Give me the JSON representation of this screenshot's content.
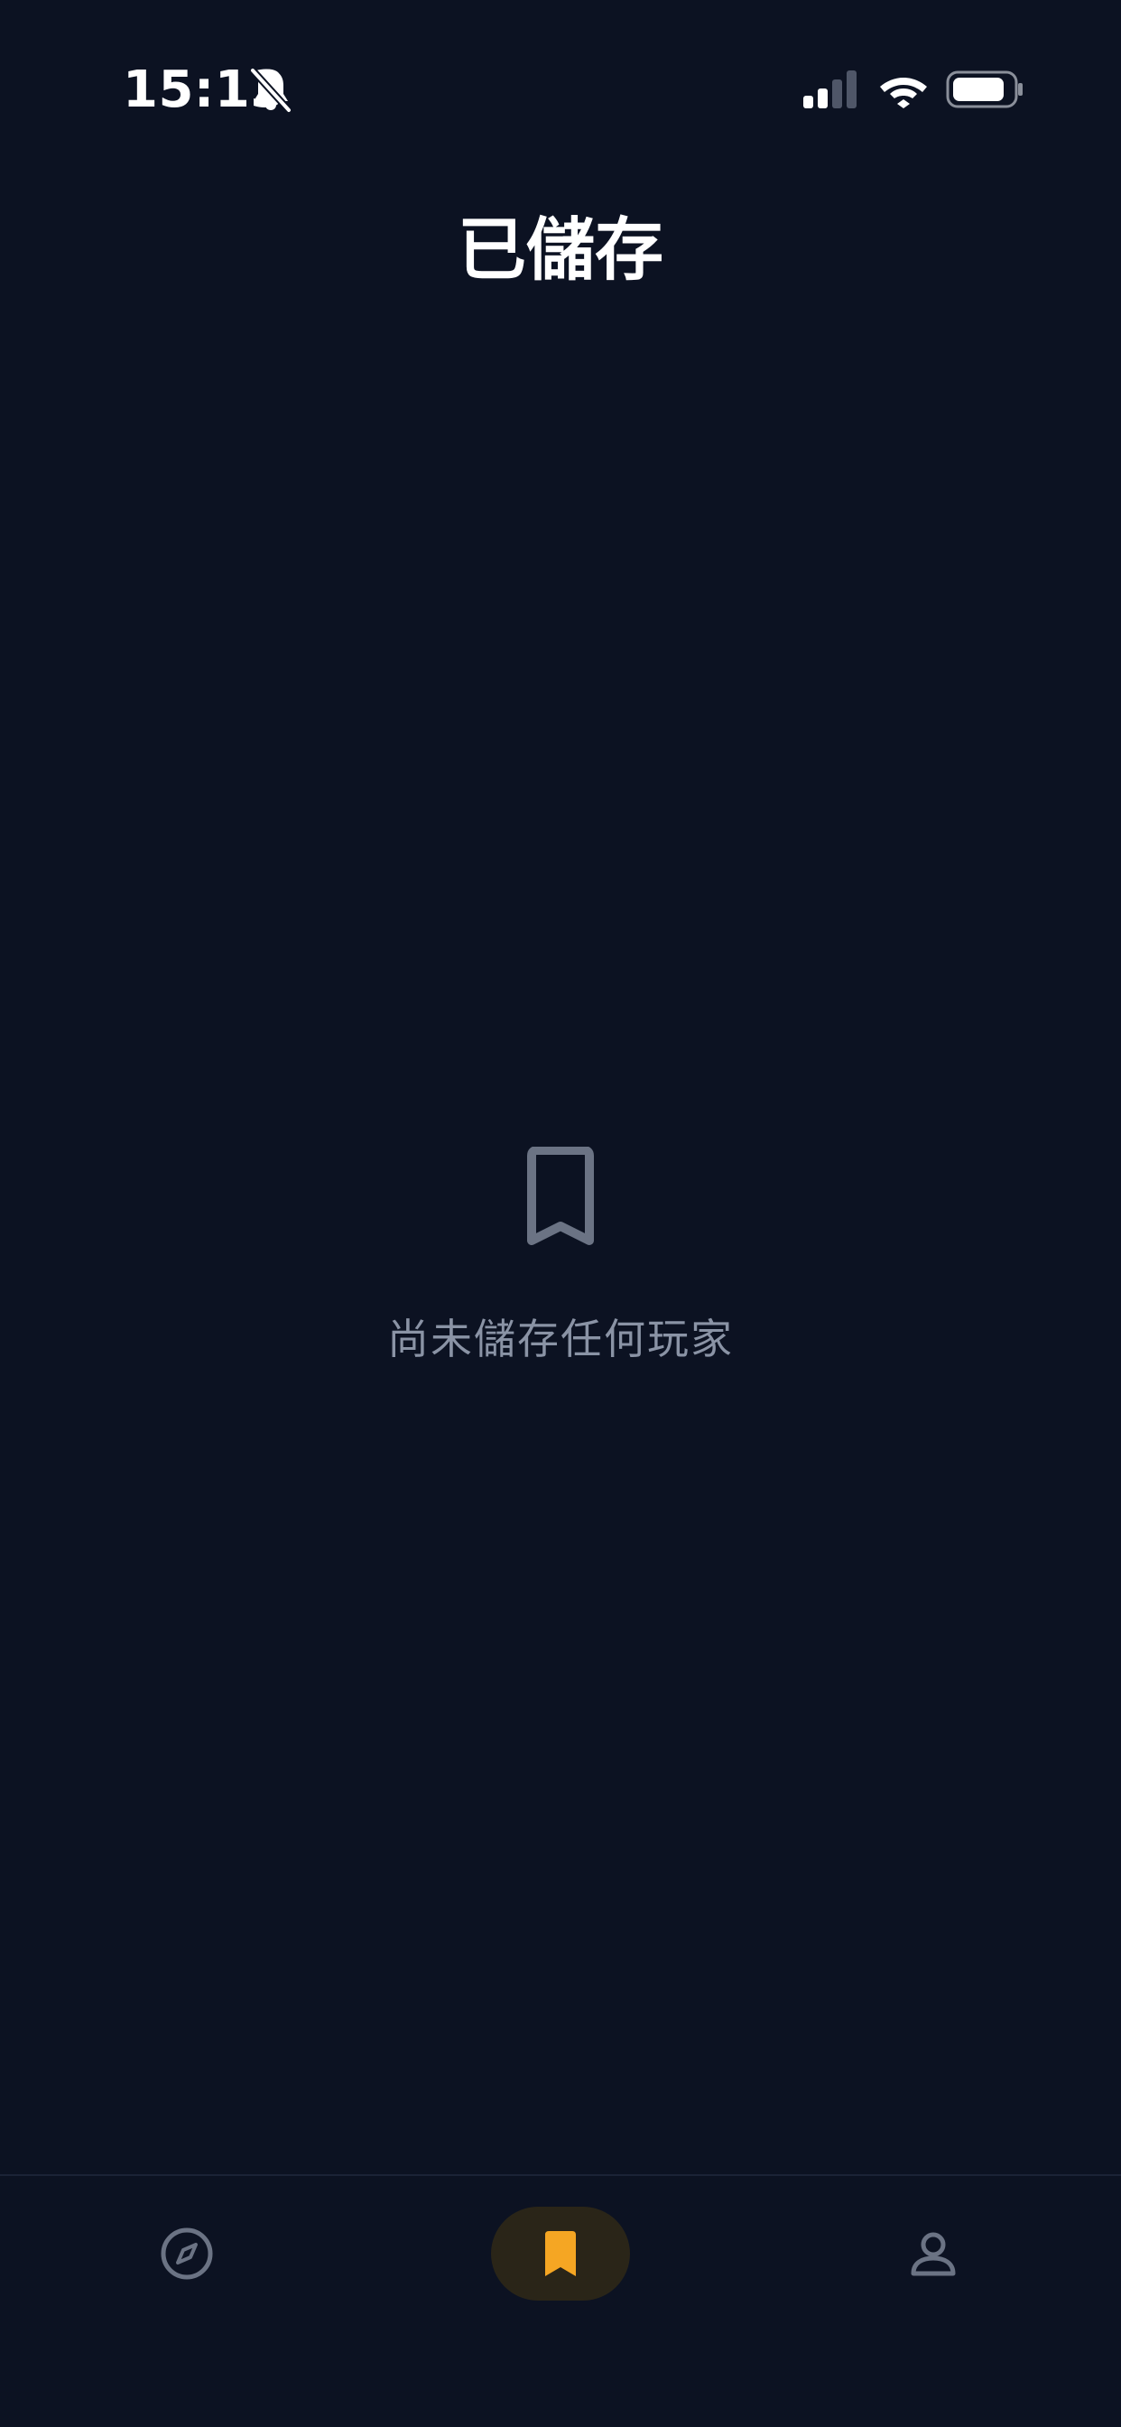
{
  "status_bar": {
    "time": "15:13",
    "icons": [
      "bell-slash-icon",
      "signal-icon",
      "wifi-icon",
      "battery-icon"
    ]
  },
  "header": {
    "title": "已儲存"
  },
  "empty_state": {
    "icon": "bookmark-icon",
    "message": "尚未儲存任何玩家"
  },
  "tab_bar": {
    "tabs": [
      {
        "icon": "compass-icon",
        "active": false
      },
      {
        "icon": "bookmark-icon",
        "active": true
      },
      {
        "icon": "person-icon",
        "active": false
      }
    ]
  },
  "colors": {
    "background": "#0c1222",
    "accent": "#f5a623",
    "muted_text": "#8a93a5",
    "icon_muted": "#6b7384",
    "active_pill": "#2a2518"
  }
}
